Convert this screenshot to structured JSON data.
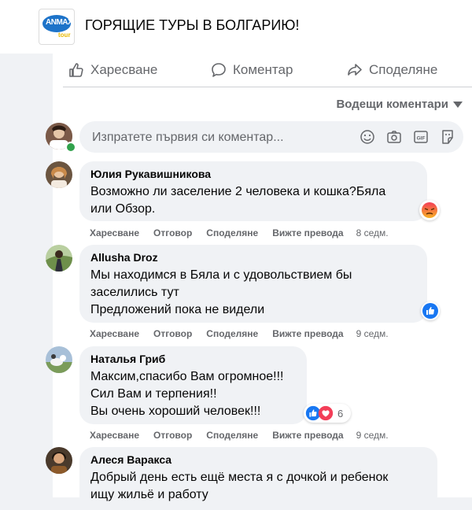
{
  "post": {
    "title": "ГОРЯЩИЕ ТУРЫ В БОЛГАРИЮ!",
    "logo_text": "ANMAX",
    "logo_sub": "tour"
  },
  "actions": {
    "like": "Харесване",
    "comment": "Коментар",
    "share": "Споделяне"
  },
  "sort_label": "Водещи коментари",
  "comment_input": {
    "placeholder": "Изпратете първия си коментар..."
  },
  "comments": [
    {
      "author": "Юлия Рукавишникова",
      "lines": [
        "Возможно ли заселение 2 человека и кошка?Бяла",
        "или Обзор."
      ],
      "reaction": "angry-icon",
      "time": "8 седм."
    },
    {
      "author": "Allusha Droz",
      "lines": [
        "Мы находимся в Бяла и с удовольствием бы",
        "заселились тут",
        "Предложений пока не видели"
      ],
      "reaction": "like-icon",
      "time": "9 седм."
    },
    {
      "author": "Наталья Гриб",
      "lines": [
        "Максим,спасибо Вам огромное!!!",
        "Сил Вам и терпения!!",
        "Вы очень хороший человек!!!"
      ],
      "reaction": "like-love-icons",
      "reaction_count": "6",
      "time": "9 седм."
    },
    {
      "author": "Алеся Варакса",
      "lines": [
        "Добрый день есть ещё места я с дочкой и ребенок",
        "ищу жильё и работу"
      ]
    }
  ],
  "comment_actions": {
    "like": "Харесване",
    "reply": "Отговор",
    "share": "Споделяне",
    "translate": "Вижте превода"
  },
  "colors": {
    "reaction_blue": "#1877f2",
    "reaction_red": "#f33e58",
    "online_green": "#31a24c",
    "angry_orange": "#e9710f"
  }
}
